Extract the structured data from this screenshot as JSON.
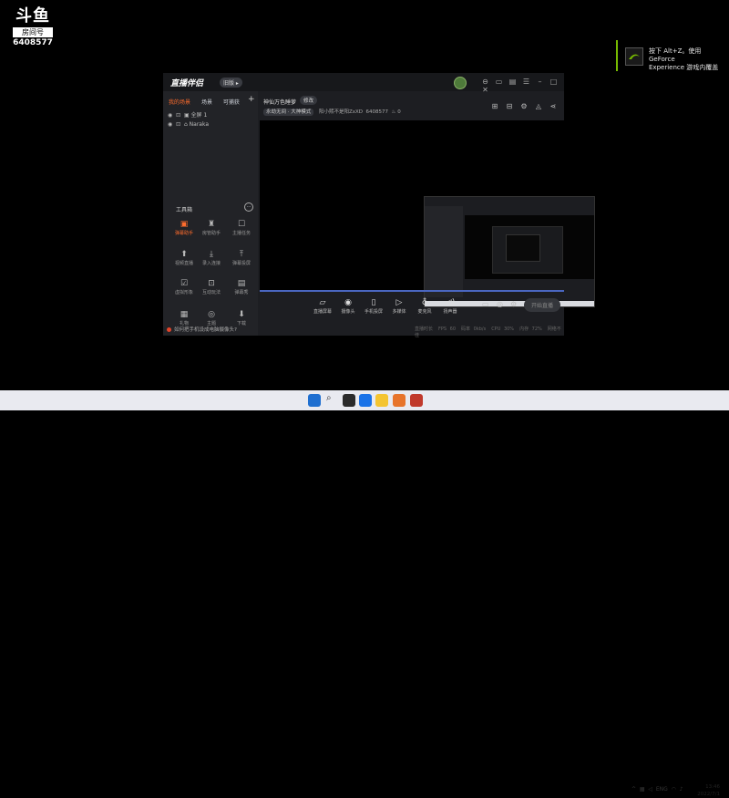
{
  "watermark": {
    "logo": "斗鱼",
    "room_label": "房间号",
    "room_number": "6408577"
  },
  "nvidia_toast": {
    "line1": "按下 Alt+Z。使用 GeForce",
    "line2": "Experience 游戏内覆盖"
  },
  "app": {
    "logo_text": "直播伴侣",
    "version_badge": "旧版 ▸",
    "left_tabs": [
      "我的场景",
      "场景",
      "可捕获"
    ],
    "scenes": [
      {
        "name": "全屏 1",
        "icon": "monitor-icon"
      },
      {
        "name": "Naraka",
        "icon": "gamepad-icon"
      }
    ],
    "tools_label": "工具箱",
    "tools": [
      {
        "label": "弹幕助手",
        "icon": "▣",
        "selected": true
      },
      {
        "label": "房管助手",
        "icon": "♜",
        "selected": false
      },
      {
        "label": "主播任务",
        "icon": "☐",
        "selected": false
      },
      {
        "label": "视频直播",
        "icon": "⬆",
        "selected": false
      },
      {
        "label": "录入连接",
        "icon": "⤓",
        "selected": false
      },
      {
        "label": "弹幕投屏",
        "icon": "⤒",
        "selected": false
      },
      {
        "label": "虚拟形象",
        "icon": "☑",
        "selected": false
      },
      {
        "label": "互动玩法",
        "icon": "⊡",
        "selected": false
      },
      {
        "label": "弹幕秀",
        "icon": "▤",
        "selected": false
      },
      {
        "label": "礼物",
        "icon": "▦",
        "selected": false
      },
      {
        "label": "主题",
        "icon": "◎",
        "selected": false
      },
      {
        "label": "下载",
        "icon": "⬇",
        "selected": false
      }
    ],
    "tip": "如何把手机设成电脑摄像头?",
    "room_title": "神仙万色睡萝",
    "edit_label": "修改",
    "room_category": "永劫无间 · 大神模式",
    "room_owner": "阳小熙不是阳ZxXD",
    "room_id": "6408577",
    "room_hot": "0",
    "controls": [
      {
        "label": "直播屏幕",
        "icon": "▱"
      },
      {
        "label": "摄像头",
        "icon": "◉"
      },
      {
        "label": "手机投屏",
        "icon": "▯"
      },
      {
        "label": "多媒体",
        "icon": "▷"
      },
      {
        "label": "麦克风",
        "icon": "♁"
      },
      {
        "label": "扬声器",
        "icon": "◁)"
      }
    ],
    "go_live_label": "开始直播",
    "status_items": [
      "直播时长",
      "FPS 60",
      "码率 0kb/s",
      "CPU 30%",
      "内存 72%",
      "网络不佳"
    ]
  },
  "taskbar": {
    "tray_lang": "ENG",
    "time": "13:46",
    "date": "2022/7/1"
  },
  "colors": {
    "accent": "#ff6c2d",
    "nvidia": "#76b900"
  }
}
